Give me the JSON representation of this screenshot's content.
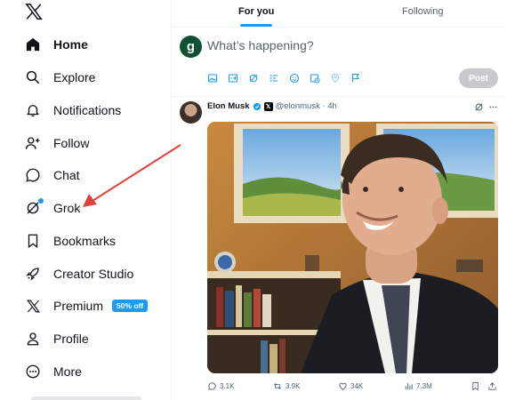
{
  "sidebar": {
    "logo": "x-logo-icon",
    "items": [
      {
        "label": "Home",
        "icon": "home-icon",
        "active": true
      },
      {
        "label": "Explore",
        "icon": "search-icon"
      },
      {
        "label": "Notifications",
        "icon": "bell-icon"
      },
      {
        "label": "Follow",
        "icon": "follow-icon"
      },
      {
        "label": "Chat",
        "icon": "chat-icon"
      },
      {
        "label": "Grok",
        "icon": "grok-icon"
      },
      {
        "label": "Bookmarks",
        "icon": "bookmark-icon"
      },
      {
        "label": "Creator Studio",
        "icon": "rocket-icon"
      },
      {
        "label": "Premium",
        "icon": "x-icon",
        "badge": "50% off"
      },
      {
        "label": "Profile",
        "icon": "person-icon"
      },
      {
        "label": "More",
        "icon": "more-icon"
      }
    ]
  },
  "tabs": [
    {
      "label": "For you",
      "active": true
    },
    {
      "label": "Following"
    }
  ],
  "compose": {
    "avatar_letter": "g",
    "placeholder": "What’s happening?",
    "toolbar_icons": [
      "image-icon",
      "gif-icon",
      "grok-icon",
      "poll-icon",
      "emoji-icon",
      "schedule-icon",
      "location-icon",
      "flag-icon"
    ],
    "post_label": "Post"
  },
  "tweet": {
    "author": "Elon Musk",
    "handle": "@elonmusk · 4h",
    "affiliate_badge": "𝕏",
    "stats": {
      "replies": "3.1K",
      "reposts": "3.9K",
      "likes": "34K",
      "views": "7.3M"
    }
  },
  "colors": {
    "accent": "#1d9bf0",
    "text": "#0f1419",
    "muted": "#536471",
    "arrow": "#e0423a"
  }
}
